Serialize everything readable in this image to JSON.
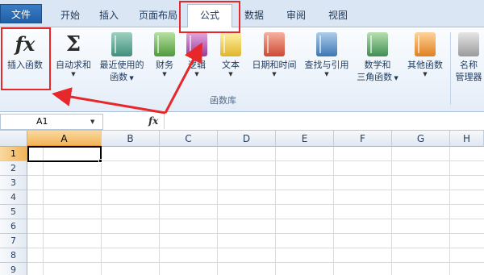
{
  "tabs": [
    {
      "label": "文件"
    },
    {
      "label": "开始"
    },
    {
      "label": "插入"
    },
    {
      "label": "页面布局"
    },
    {
      "label": "公式"
    },
    {
      "label": "数据"
    },
    {
      "label": "审阅"
    },
    {
      "label": "视图"
    }
  ],
  "ribbon": {
    "insert_function": {
      "label": "插入函数",
      "icon": "fx-icon"
    },
    "autosum": {
      "label": "自动求和",
      "icon": "sigma-icon"
    },
    "recent": {
      "line1": "最近使用的",
      "line2": "函数"
    },
    "financial": {
      "label": "财务"
    },
    "logical": {
      "label": "逻辑"
    },
    "text": {
      "label": "文本"
    },
    "datetime": {
      "label": "日期和时间"
    },
    "lookup": {
      "label": "查找与引用"
    },
    "math": {
      "line1": "数学和",
      "line2": "三角函数"
    },
    "more": {
      "label": "其他函数"
    },
    "name_manager": {
      "line1": "名称",
      "line2": "管理器"
    },
    "group_label": "函数库"
  },
  "formula_bar": {
    "name_box": "A1",
    "fx": "fx",
    "value": ""
  },
  "columns": [
    "A",
    "B",
    "C",
    "D",
    "E",
    "F",
    "G",
    "H"
  ],
  "rows": [
    "1",
    "2",
    "3",
    "4",
    "5",
    "6",
    "7",
    "8",
    "9"
  ],
  "colors": {
    "annotation": "#e8272b",
    "file_tab": "#1f5fa8",
    "selected_header": "#f2b45a"
  }
}
